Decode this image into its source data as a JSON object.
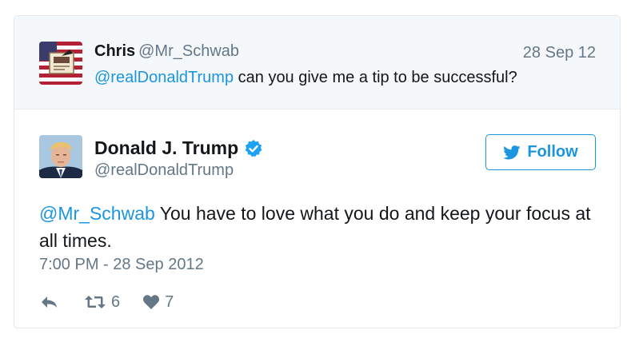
{
  "reply": {
    "name": "Chris",
    "handle": "@Mr_Schwab",
    "date": "28 Sep 12",
    "mention": "@realDonaldTrump",
    "text": " can you give me a tip to be successful?",
    "avatar_icon": "flag-avatar-icon"
  },
  "tweet": {
    "name": "Donald J. Trump",
    "handle": "@realDonaldTrump",
    "verified_icon": "verified-badge-icon",
    "follow_label": "Follow",
    "mention": "@Mr_Schwab",
    "text": " You have to love what you do and keep your focus at all times.",
    "timestamp": "7:00 PM - 28 Sep 2012",
    "retweet_count": "6",
    "like_count": "7"
  },
  "colors": {
    "accent": "#1b95e0",
    "muted": "#657786",
    "text": "#14171a",
    "reply_bg": "#f5f8fa"
  }
}
